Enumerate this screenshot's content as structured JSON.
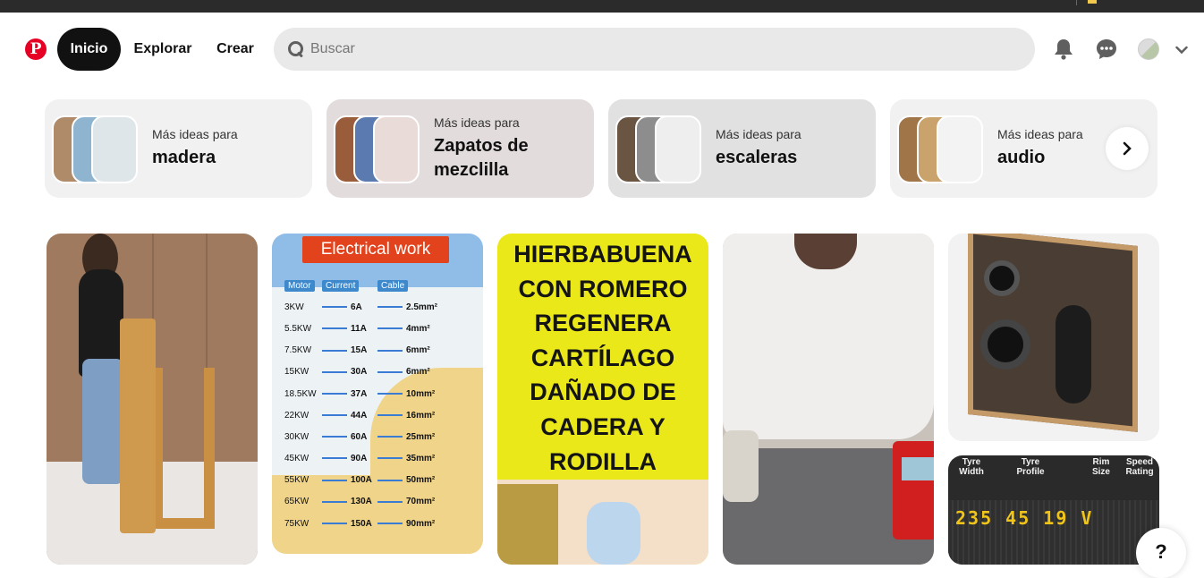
{
  "header": {
    "logo_letter": "P",
    "nav": {
      "home": "Inicio",
      "explore": "Explorar",
      "create": "Crear"
    },
    "search_placeholder": "Buscar"
  },
  "ideas": [
    {
      "small": "Más ideas para",
      "big": "madera",
      "bg": "#f1f1f1"
    },
    {
      "small": "Más ideas para",
      "big": "Zapatos de mezclilla",
      "bg": "#e3dcdc"
    },
    {
      "small": "Más ideas para",
      "big": "escaleras",
      "bg": "#e1e1e1"
    },
    {
      "small": "Más ideas para",
      "big": "audio",
      "bg": "#f1f1f1"
    }
  ],
  "pins": {
    "electrical": {
      "title": "Electrical work",
      "headers": [
        "Motor",
        "Current",
        "Cable"
      ],
      "rows": [
        [
          "3KW",
          "6A",
          "2.5mm²"
        ],
        [
          "5.5KW",
          "11A",
          "4mm²"
        ],
        [
          "7.5KW",
          "15A",
          "6mm²"
        ],
        [
          "15KW",
          "30A",
          "6mm²"
        ],
        [
          "18.5KW",
          "37A",
          "10mm²"
        ],
        [
          "22KW",
          "44A",
          "16mm²"
        ],
        [
          "30KW",
          "60A",
          "25mm²"
        ],
        [
          "45KW",
          "90A",
          "35mm²"
        ],
        [
          "55KW",
          "100A",
          "50mm²"
        ],
        [
          "65KW",
          "130A",
          "70mm²"
        ],
        [
          "75KW",
          "150A",
          "90mm²"
        ]
      ]
    },
    "herbal": {
      "lines": [
        "HIERBABUENA",
        "CON ROMERO",
        "REGENERA",
        "CARTÍLAGO",
        "DAÑADO DE",
        "CADERA Y",
        "RODILLA"
      ]
    },
    "tyre": {
      "labels": [
        "Tyre Width",
        "Tyre Profile",
        "Rim Size",
        "Speed Rating"
      ],
      "code": "235 45 19 V"
    }
  },
  "help_label": "?",
  "colors": {
    "brand": "#e60023",
    "active_nav": "#111111",
    "search_bg": "#e9e9e9"
  }
}
